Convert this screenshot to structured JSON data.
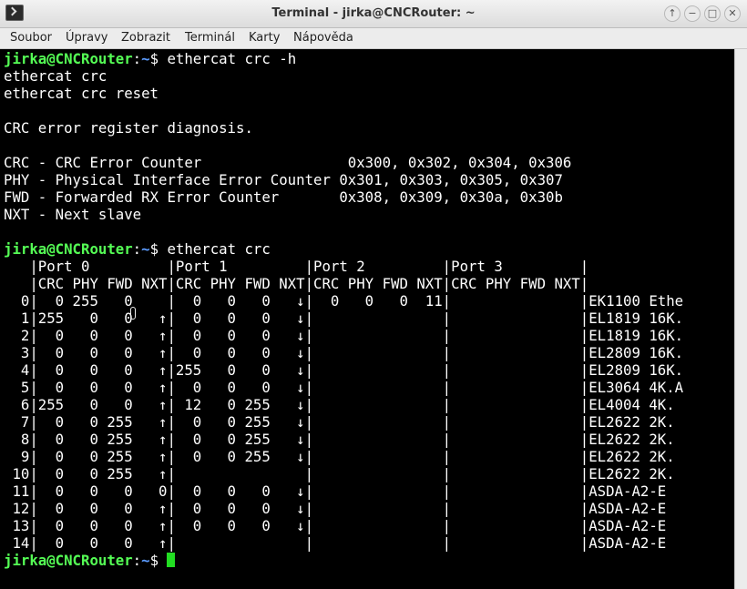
{
  "window": {
    "title": "Terminal - jirka@CNCRouter: ~",
    "buttons": [
      "↑",
      "−",
      "□",
      "✕"
    ]
  },
  "menu": [
    "Soubor",
    "Úpravy",
    "Zobrazit",
    "Terminál",
    "Karty",
    "Nápověda"
  ],
  "terminal": {
    "prompt": {
      "user": "jirka@CNCRouter",
      "sep": ":",
      "path": "~",
      "sym": "$ "
    },
    "lines": [
      {
        "type": "cmd",
        "cmd": "ethercat crc -h"
      },
      {
        "type": "out",
        "text": "ethercat crc"
      },
      {
        "type": "out",
        "text": "ethercat crc reset"
      },
      {
        "type": "out",
        "text": ""
      },
      {
        "type": "out",
        "text": "CRC error register diagnosis."
      },
      {
        "type": "out",
        "text": ""
      },
      {
        "type": "out",
        "text": "CRC - CRC Error Counter                 0x300, 0x302, 0x304, 0x306"
      },
      {
        "type": "out",
        "text": "PHY - Physical Interface Error Counter 0x301, 0x303, 0x305, 0x307"
      },
      {
        "type": "out",
        "text": "FWD - Forwarded RX Error Counter       0x308, 0x309, 0x30a, 0x30b"
      },
      {
        "type": "out",
        "text": "NXT - Next slave"
      },
      {
        "type": "out",
        "text": ""
      },
      {
        "type": "cmd",
        "cmd": "ethercat crc"
      },
      {
        "type": "out",
        "text": "   |Port 0         |Port 1         |Port 2         |Port 3         |"
      },
      {
        "type": "out",
        "text": "   |CRC PHY FWD NXT|CRC PHY FWD NXT|CRC PHY FWD NXT|CRC PHY FWD NXT|"
      },
      {
        "type": "out",
        "text": "  0|  0 255   0    |  0   0   0   ↓|  0   0   0  11|               |EK1100 Ethe"
      },
      {
        "type": "out",
        "text": "  1|255   0   0   ↑|  0   0   0   ↓|               |               |EL1819 16K."
      },
      {
        "type": "out",
        "text": "  2|  0   0   0   ↑|  0   0   0   ↓|               |               |EL1819 16K."
      },
      {
        "type": "out",
        "text": "  3|  0   0   0   ↑|  0   0   0   ↓|               |               |EL2809 16K."
      },
      {
        "type": "out",
        "text": "  4|  0   0   0   ↑|255   0   0   ↓|               |               |EL2809 16K."
      },
      {
        "type": "out",
        "text": "  5|  0   0   0   ↑|  0   0   0   ↓|               |               |EL3064 4K.A"
      },
      {
        "type": "out",
        "text": "  6|255   0   0   ↑| 12   0 255   ↓|               |               |EL4004 4K."
      },
      {
        "type": "out",
        "text": "  7|  0   0 255   ↑|  0   0 255   ↓|               |               |EL2622 2K."
      },
      {
        "type": "out",
        "text": "  8|  0   0 255   ↑|  0   0 255   ↓|               |               |EL2622 2K."
      },
      {
        "type": "out",
        "text": "  9|  0   0 255   ↑|  0   0 255   ↓|               |               |EL2622 2K."
      },
      {
        "type": "out",
        "text": " 10|  0   0 255   ↑|               |               |               |EL2622 2K."
      },
      {
        "type": "out",
        "text": " 11|  0   0   0   0|  0   0   0   ↓|               |               |ASDA-A2-E"
      },
      {
        "type": "out",
        "text": " 12|  0   0   0   ↑|  0   0   0   ↓|               |               |ASDA-A2-E"
      },
      {
        "type": "out",
        "text": " 13|  0   0   0   ↑|  0   0   0   ↓|               |               |ASDA-A2-E"
      },
      {
        "type": "out",
        "text": " 14|  0   0   0   ↑|               |               |               |ASDA-A2-E"
      },
      {
        "type": "cmd",
        "cmd": ""
      }
    ]
  }
}
